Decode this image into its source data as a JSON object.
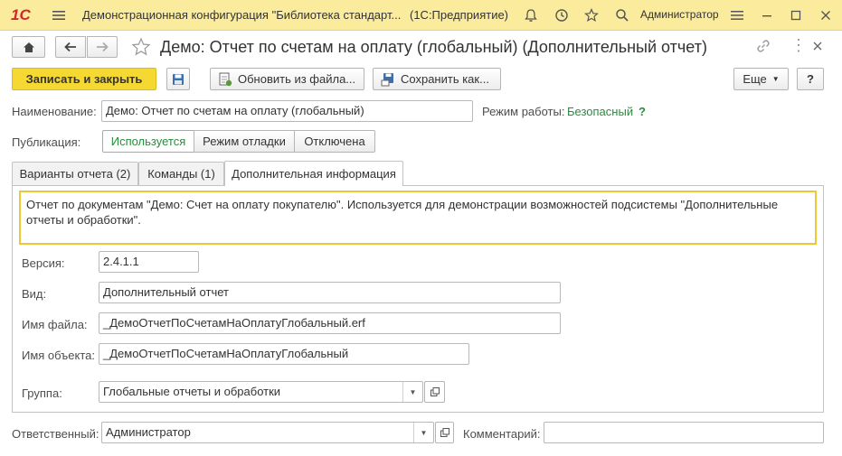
{
  "titlebar": {
    "logo": "1С",
    "app_title": "Демонстрационная конфигурация \"Библиотека стандарт...",
    "platform": "(1С:Предприятие)",
    "user": "Администратор"
  },
  "form": {
    "title": "Демо: Отчет по счетам на оплату (глобальный) (Дополнительный отчет)"
  },
  "toolbar": {
    "save_close": "Записать и закрыть",
    "update_from_file": "Обновить из файла...",
    "save_as": "Сохранить как...",
    "more": "Еще",
    "help": "?"
  },
  "name_row": {
    "label": "Наименование:",
    "value": "Демо: Отчет по счетам на оплату (глобальный)",
    "mode_label": "Режим работы:",
    "mode_value": "Безопасный",
    "mode_help": "?"
  },
  "publication": {
    "label": "Публикация:",
    "options": [
      "Используется",
      "Режим отладки",
      "Отключена"
    ]
  },
  "tabs": [
    "Варианты отчета (2)",
    "Команды (1)",
    "Дополнительная информация"
  ],
  "info": {
    "description": "Отчет по документам \"Демо: Счет на оплату покупателю\". Используется для демонстрации возможностей подсистемы \"Дополнительные отчеты и обработки\".",
    "version_label": "Версия:",
    "version_value": "2.4.1.1",
    "kind_label": "Вид:",
    "kind_value": "Дополнительный отчет",
    "file_label": "Имя файла:",
    "file_value": "_ДемоОтчетПоСчетамНаОплатуГлобальный.erf",
    "object_label": "Имя объекта:",
    "object_value": "_ДемоОтчетПоСчетамНаОплатуГлобальный",
    "group_label": "Группа:",
    "group_value": "Глобальные отчеты и обработки"
  },
  "footer": {
    "responsible_label": "Ответственный:",
    "responsible_value": "Администратор",
    "comment_label": "Комментарий:",
    "comment_value": ""
  },
  "colors": {
    "titlebar_bg": "#fbeb9c",
    "accent_yellow": "#f5d932",
    "active_green": "#2a8b3e",
    "logo_red": "#d4262e"
  }
}
